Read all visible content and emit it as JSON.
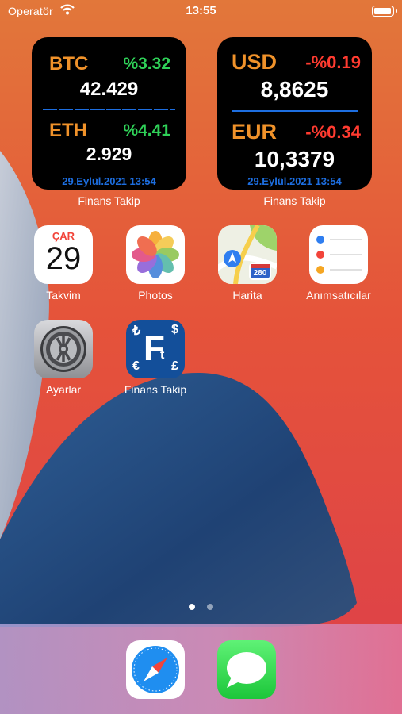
{
  "status_bar": {
    "carrier": "Operatör",
    "time": "13:55",
    "battery_level": 1.0
  },
  "crypto_widget": {
    "rows": [
      {
        "symbol": "BTC",
        "change": "%3.32",
        "price": "42.429"
      },
      {
        "symbol": "ETH",
        "change": "%4.41",
        "price": "2.929"
      }
    ],
    "date": "29.Eylül.2021  13:54",
    "caption": "Finans Takip",
    "positive_color": "#2fd158"
  },
  "currency_widget": {
    "rows": [
      {
        "symbol": "USD",
        "change": "-%0.19",
        "price": "8,8625"
      },
      {
        "symbol": "EUR",
        "change": "-%0.34",
        "price": "10,3379"
      }
    ],
    "date": "29.Eylül.2021  13:54",
    "caption": "Finans Takip",
    "negative_color": "#ff3b30"
  },
  "apps": [
    {
      "label": "Takvim",
      "icon": "calendar-icon",
      "weekday": "ÇAR",
      "day": "29"
    },
    {
      "label": "Photos",
      "icon": "photos-icon"
    },
    {
      "label": "Harita",
      "icon": "maps-icon",
      "route_number": "280"
    },
    {
      "label": "Anımsatıcılar",
      "icon": "reminders-icon"
    },
    {
      "label": "Ayarlar",
      "icon": "settings-gear-icon"
    },
    {
      "label": "Finans Takip",
      "icon": "finans-takip-icon",
      "logo_letter": "F",
      "logo_small": "t",
      "currency_symbols": [
        "₺",
        "$",
        "€",
        "£"
      ]
    }
  ],
  "page_indicator": {
    "pages": 2,
    "current": 1
  },
  "dock": [
    {
      "icon": "safari-compass-icon"
    },
    {
      "icon": "messages-bubble-icon"
    }
  ],
  "colors": {
    "accent_orange": "#f0922a",
    "date_blue": "#1d6ee0"
  }
}
